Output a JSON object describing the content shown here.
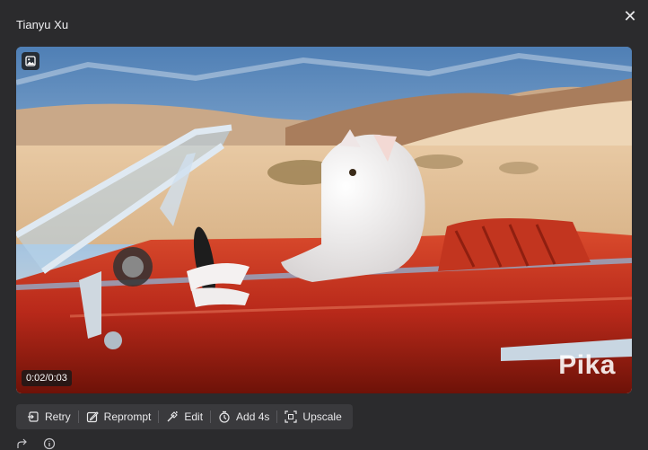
{
  "header": {
    "title": "Tianyu Xu",
    "close_icon": "close-icon"
  },
  "video": {
    "timecode": "0:02/0:03",
    "watermark": "Pika",
    "badge_icon": "image-icon"
  },
  "toolbar": {
    "items": [
      {
        "label": "Retry",
        "icon": "retry-icon"
      },
      {
        "label": "Reprompt",
        "icon": "edit-pencil-icon"
      },
      {
        "label": "Edit",
        "icon": "magic-wand-icon"
      },
      {
        "label": "Add 4s",
        "icon": "timer-icon"
      },
      {
        "label": "Upscale",
        "icon": "expand-icon"
      }
    ]
  },
  "footer": {
    "icons": [
      "share-icon",
      "info-icon"
    ]
  }
}
